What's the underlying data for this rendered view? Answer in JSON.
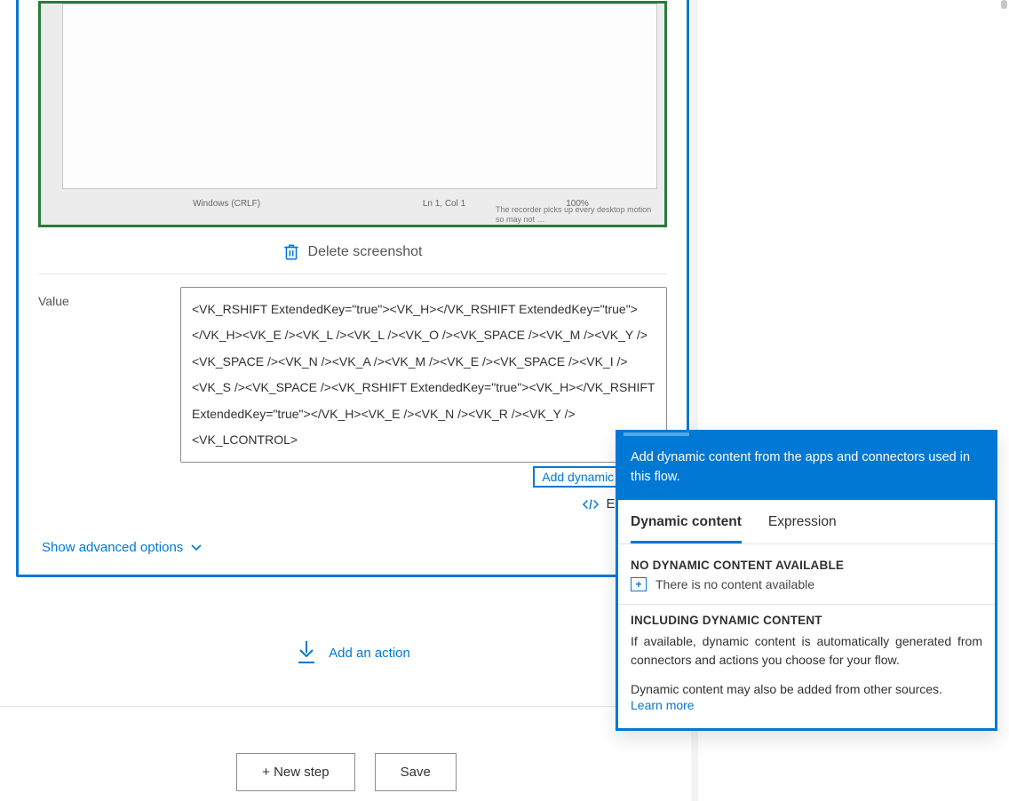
{
  "screenshot_caption": {
    "status_center": "Windows (CRLF)",
    "status_mid": "Ln 1, Col 1",
    "status_right": "100%",
    "footnote": "The recorder picks up every desktop motion so may not …"
  },
  "card": {
    "delete_label": "Delete screenshot",
    "value_label": "Value",
    "value_text": "<VK_RSHIFT ExtendedKey=\"true\"><VK_H></VK_RSHIFT ExtendedKey=\"true\"></VK_H><VK_E /><VK_L /><VK_L /><VK_O /><VK_SPACE /><VK_M /><VK_Y /><VK_SPACE /><VK_N /><VK_A /><VK_M /><VK_E /><VK_SPACE /><VK_I /><VK_S /><VK_SPACE /><VK_RSHIFT ExtendedKey=\"true\"><VK_H></VK_RSHIFT ExtendedKey=\"true\"></VK_H><VK_E /><VK_N /><VK_R /><VK_Y /><VK_LCONTROL>",
    "add_dynamic_link": "Add dynamic content",
    "edit_code_label": "Edit code",
    "advanced_label": "Show advanced options"
  },
  "actions": {
    "add_action": "Add an action",
    "new_step": "+ New step",
    "save": "Save"
  },
  "popout": {
    "header": "Add dynamic content from the apps and connectors used in this flow.",
    "tab_dynamic": "Dynamic content",
    "tab_expression": "Expression",
    "no_dc_heading": "NO DYNAMIC CONTENT AVAILABLE",
    "no_dc_text": "There is no content available",
    "incl_heading": "INCLUDING DYNAMIC CONTENT",
    "incl_para": "If available, dynamic content is automatically generated from connectors and actions you choose for your flow.",
    "other_sources": "Dynamic content may also be added from other sources.",
    "learn_more": "Learn more"
  }
}
